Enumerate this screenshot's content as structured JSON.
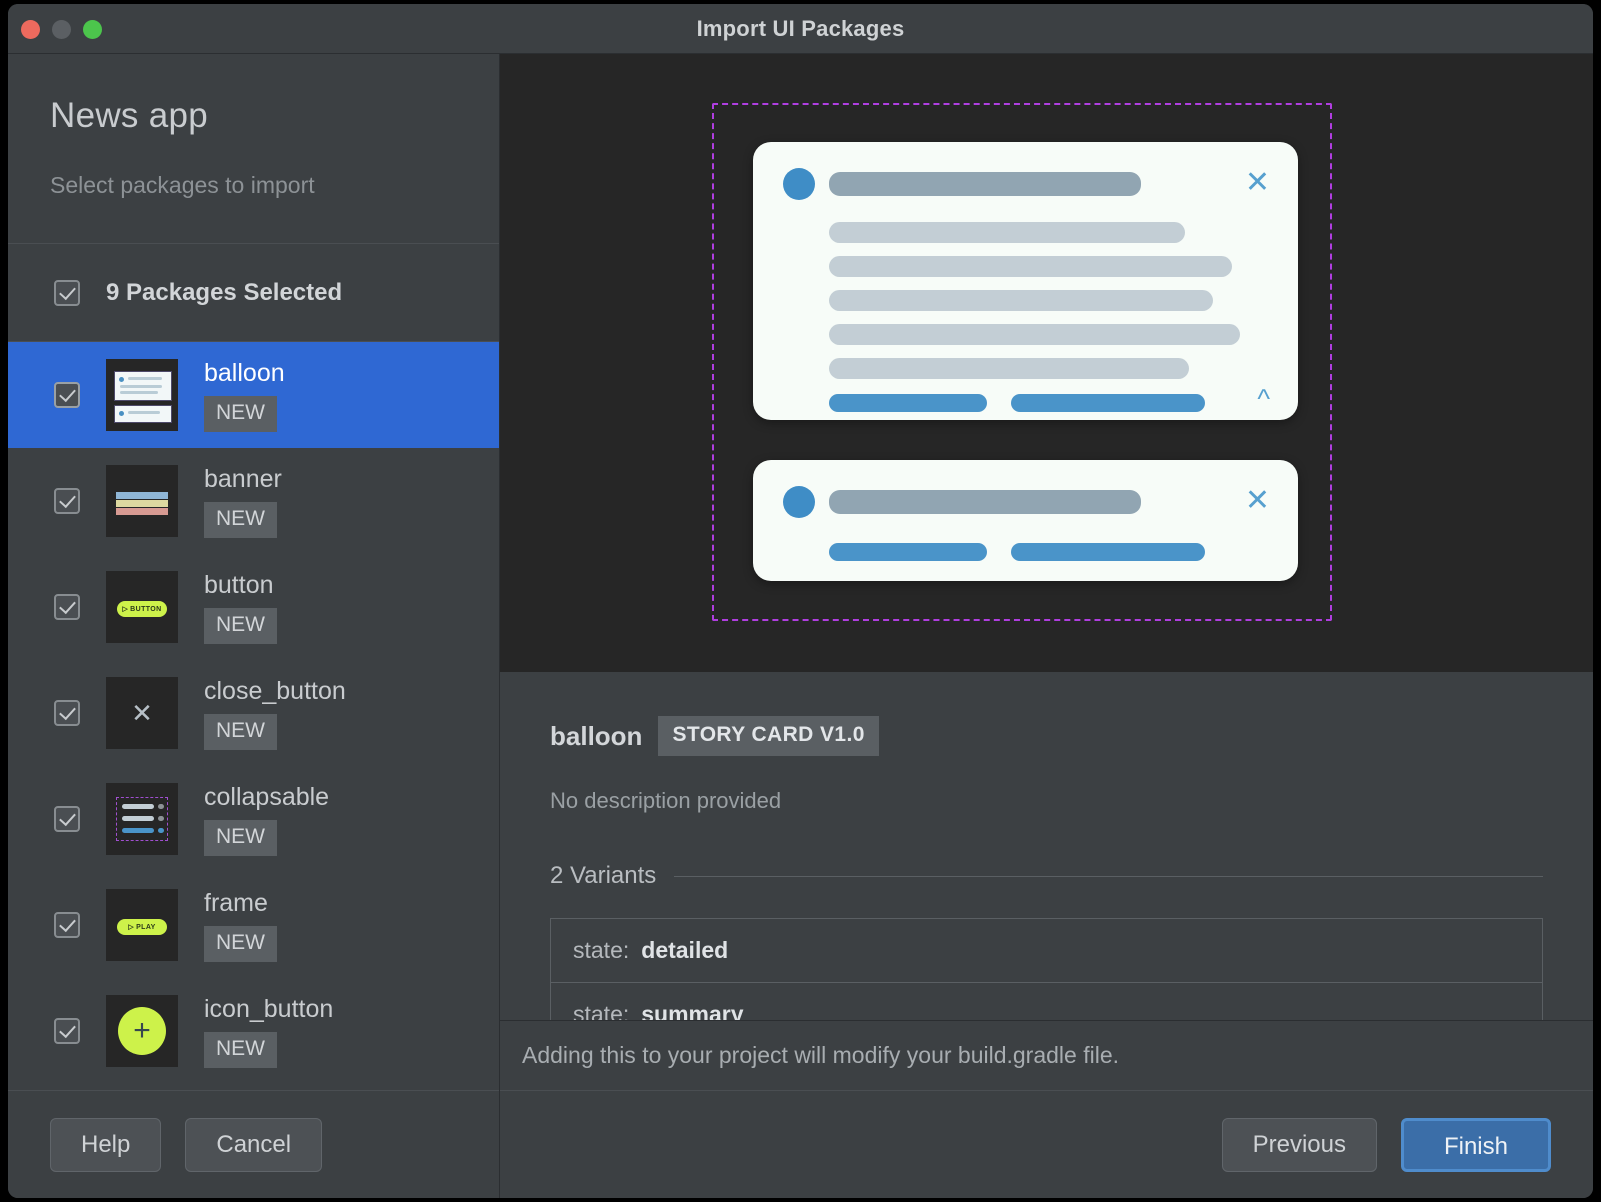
{
  "window": {
    "title": "Import UI Packages",
    "traffic_lights": [
      "close-button",
      "minimize-button",
      "zoom-button"
    ]
  },
  "sidebar": {
    "title": "News app",
    "subtitle": "Select packages to import",
    "select_all_label": "9 Packages Selected",
    "select_all_checked": true,
    "packages": [
      {
        "name": "balloon",
        "badge": "NEW",
        "checked": true,
        "selected": true,
        "thumb": "balloon-thumb"
      },
      {
        "name": "banner",
        "badge": "NEW",
        "checked": true,
        "selected": false,
        "thumb": "banner-thumb"
      },
      {
        "name": "button",
        "badge": "NEW",
        "checked": true,
        "selected": false,
        "thumb": "button-thumb",
        "thumb_text": "BUTTON"
      },
      {
        "name": "close_button",
        "badge": "NEW",
        "checked": true,
        "selected": false,
        "thumb": "close-thumb"
      },
      {
        "name": "collapsable",
        "badge": "NEW",
        "checked": true,
        "selected": false,
        "thumb": "collapsable-thumb"
      },
      {
        "name": "frame",
        "badge": "NEW",
        "checked": true,
        "selected": false,
        "thumb": "frame-thumb",
        "thumb_text": "PLAY"
      },
      {
        "name": "icon_button",
        "badge": "NEW",
        "checked": true,
        "selected": false,
        "thumb": "icon-button-thumb"
      }
    ],
    "footer": {
      "help_label": "Help",
      "cancel_label": "Cancel"
    }
  },
  "preview": {
    "frame_style": "dashed-selection-frame",
    "cards": [
      {
        "id": "detailed-card",
        "close_icon": "close-icon",
        "chevron_icon": "chevron-up-icon"
      },
      {
        "id": "summary-card",
        "close_icon": "close-icon"
      }
    ]
  },
  "details": {
    "name": "balloon",
    "tag": "STORY CARD V1.0",
    "description": "No description provided",
    "variants_label": "2 Variants",
    "variants": [
      {
        "key": "state:",
        "value": "detailed"
      },
      {
        "key": "state:",
        "value": "summary"
      }
    ]
  },
  "status": {
    "message": "Adding this to your project will modify your build.gradle file."
  },
  "footer": {
    "previous_label": "Previous",
    "finish_label": "Finish"
  },
  "colors": {
    "window_bg": "#3c4043",
    "preview_bg": "#262626",
    "selection_blue": "#2f68d3",
    "primary_button": "#3b6ea8",
    "dash_purple": "#b03ee0",
    "accent_lime": "#cdf24a",
    "card_blue": "#4a94c9"
  }
}
